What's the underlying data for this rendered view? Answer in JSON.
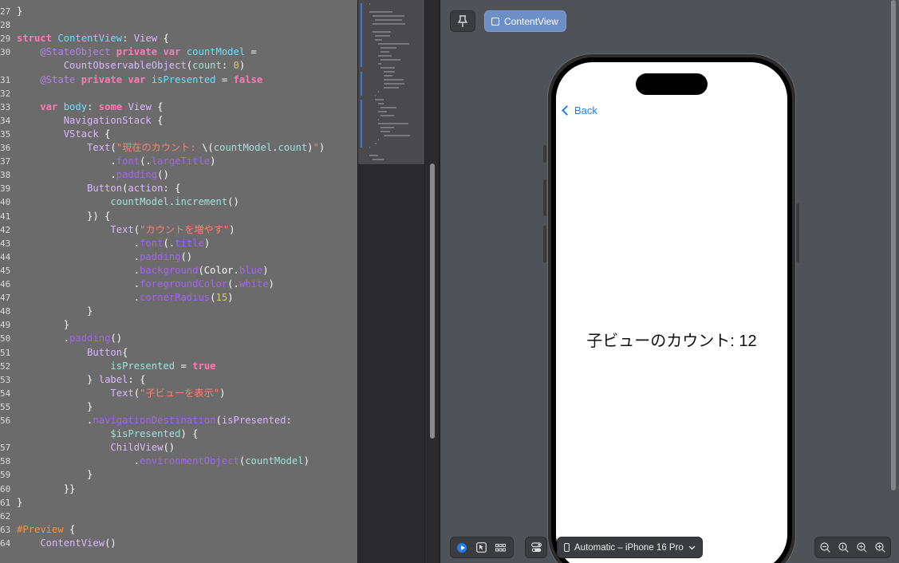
{
  "editor": {
    "lines": [
      {
        "n": "27",
        "segs": [
          {
            "t": "}",
            "c": "plain"
          }
        ]
      },
      {
        "n": "28",
        "segs": []
      },
      {
        "n": "29",
        "segs": [
          {
            "t": "struct ",
            "c": "kw"
          },
          {
            "t": "ContentView",
            "c": "var"
          },
          {
            "t": ": ",
            "c": "plain"
          },
          {
            "t": "View",
            "c": "tp2"
          },
          {
            "t": " {",
            "c": "plain"
          }
        ]
      },
      {
        "n": "30",
        "segs": [
          {
            "t": "    @StateObject ",
            "c": "attr"
          },
          {
            "t": "private var ",
            "c": "kw"
          },
          {
            "t": "countModel",
            "c": "var"
          },
          {
            "t": " =",
            "c": "plain"
          }
        ]
      },
      {
        "n": "",
        "segs": [
          {
            "t": "        CountObservableObject",
            "c": "tp2"
          },
          {
            "t": "(",
            "c": "plain"
          },
          {
            "t": "count",
            "c": "tp"
          },
          {
            "t": ": ",
            "c": "plain"
          },
          {
            "t": "0",
            "c": "num"
          },
          {
            "t": ")",
            "c": "plain"
          }
        ]
      },
      {
        "n": "31",
        "segs": [
          {
            "t": "    @State ",
            "c": "attr"
          },
          {
            "t": "private var ",
            "c": "kw"
          },
          {
            "t": "isPresented",
            "c": "var"
          },
          {
            "t": " = ",
            "c": "plain"
          },
          {
            "t": "false",
            "c": "kw"
          }
        ]
      },
      {
        "n": "32",
        "segs": []
      },
      {
        "n": "33",
        "segs": [
          {
            "t": "    var ",
            "c": "kw"
          },
          {
            "t": "body",
            "c": "var"
          },
          {
            "t": ": ",
            "c": "plain"
          },
          {
            "t": "some ",
            "c": "kw"
          },
          {
            "t": "View",
            "c": "tp2"
          },
          {
            "t": " {",
            "c": "plain"
          }
        ]
      },
      {
        "n": "34",
        "segs": [
          {
            "t": "        NavigationStack",
            "c": "tp2"
          },
          {
            "t": " {",
            "c": "plain"
          }
        ]
      },
      {
        "n": "35",
        "segs": [
          {
            "t": "        VStack",
            "c": "tp2"
          },
          {
            "t": " {",
            "c": "plain"
          }
        ]
      },
      {
        "n": "36",
        "segs": [
          {
            "t": "            Text",
            "c": "tp2"
          },
          {
            "t": "(",
            "c": "plain"
          },
          {
            "t": "\"現在のカウント: ",
            "c": "str"
          },
          {
            "t": "\\(",
            "c": "plain"
          },
          {
            "t": "countModel",
            "c": "tp"
          },
          {
            "t": ".",
            "c": "plain"
          },
          {
            "t": "count",
            "c": "tp"
          },
          {
            "t": ")",
            "c": "plain"
          },
          {
            "t": "\"",
            "c": "str"
          },
          {
            "t": ")",
            "c": "plain"
          }
        ]
      },
      {
        "n": "37",
        "segs": [
          {
            "t": "                .",
            "c": "plain"
          },
          {
            "t": "font",
            "c": "prop"
          },
          {
            "t": "(.",
            "c": "plain"
          },
          {
            "t": "largeTitle",
            "c": "prop"
          },
          {
            "t": ")",
            "c": "plain"
          }
        ]
      },
      {
        "n": "38",
        "segs": [
          {
            "t": "                .",
            "c": "plain"
          },
          {
            "t": "padding",
            "c": "prop"
          },
          {
            "t": "()",
            "c": "plain"
          }
        ]
      },
      {
        "n": "39",
        "segs": [
          {
            "t": "            Button",
            "c": "tp2"
          },
          {
            "t": "(",
            "c": "plain"
          },
          {
            "t": "action",
            "c": "tp2"
          },
          {
            "t": ": {",
            "c": "plain"
          }
        ]
      },
      {
        "n": "40",
        "segs": [
          {
            "t": "                countModel",
            "c": "tp"
          },
          {
            "t": ".",
            "c": "plain"
          },
          {
            "t": "increment",
            "c": "tp"
          },
          {
            "t": "()",
            "c": "plain"
          }
        ]
      },
      {
        "n": "41",
        "segs": [
          {
            "t": "            }) {",
            "c": "plain"
          }
        ]
      },
      {
        "n": "42",
        "segs": [
          {
            "t": "                Text",
            "c": "tp2"
          },
          {
            "t": "(",
            "c": "plain"
          },
          {
            "t": "\"カウントを増やす\"",
            "c": "str"
          },
          {
            "t": ")",
            "c": "plain"
          }
        ]
      },
      {
        "n": "43",
        "segs": [
          {
            "t": "                    .",
            "c": "plain"
          },
          {
            "t": "font",
            "c": "prop"
          },
          {
            "t": "(.",
            "c": "plain"
          },
          {
            "t": "title",
            "c": "prop"
          },
          {
            "t": ")",
            "c": "plain"
          }
        ]
      },
      {
        "n": "44",
        "segs": [
          {
            "t": "                    .",
            "c": "plain"
          },
          {
            "t": "padding",
            "c": "prop"
          },
          {
            "t": "()",
            "c": "plain"
          }
        ]
      },
      {
        "n": "45",
        "segs": [
          {
            "t": "                    .",
            "c": "plain"
          },
          {
            "t": "background",
            "c": "prop"
          },
          {
            "t": "(Color.",
            "c": "plain"
          },
          {
            "t": "blue",
            "c": "prop"
          },
          {
            "t": ")",
            "c": "plain"
          }
        ]
      },
      {
        "n": "46",
        "segs": [
          {
            "t": "                    .",
            "c": "plain"
          },
          {
            "t": "foregroundColor",
            "c": "prop"
          },
          {
            "t": "(.",
            "c": "plain"
          },
          {
            "t": "white",
            "c": "prop"
          },
          {
            "t": ")",
            "c": "plain"
          }
        ]
      },
      {
        "n": "47",
        "segs": [
          {
            "t": "                    .",
            "c": "plain"
          },
          {
            "t": "cornerRadius",
            "c": "prop"
          },
          {
            "t": "(",
            "c": "plain"
          },
          {
            "t": "15",
            "c": "num"
          },
          {
            "t": ")",
            "c": "plain"
          }
        ]
      },
      {
        "n": "48",
        "segs": [
          {
            "t": "            }",
            "c": "plain"
          }
        ]
      },
      {
        "n": "49",
        "segs": [
          {
            "t": "        }",
            "c": "plain"
          }
        ]
      },
      {
        "n": "50",
        "segs": [
          {
            "t": "        .",
            "c": "plain"
          },
          {
            "t": "padding",
            "c": "prop"
          },
          {
            "t": "()",
            "c": "plain"
          }
        ]
      },
      {
        "n": "51",
        "segs": [
          {
            "t": "            Button",
            "c": "tp2"
          },
          {
            "t": "{",
            "c": "plain"
          }
        ]
      },
      {
        "n": "52",
        "segs": [
          {
            "t": "                isPresented",
            "c": "tp"
          },
          {
            "t": " = ",
            "c": "plain"
          },
          {
            "t": "true",
            "c": "kw"
          }
        ]
      },
      {
        "n": "53",
        "segs": [
          {
            "t": "            } ",
            "c": "plain"
          },
          {
            "t": "label",
            "c": "tp2"
          },
          {
            "t": ": {",
            "c": "plain"
          }
        ]
      },
      {
        "n": "54",
        "segs": [
          {
            "t": "                Text",
            "c": "tp2"
          },
          {
            "t": "(",
            "c": "plain"
          },
          {
            "t": "\"子ビューを表示\"",
            "c": "str"
          },
          {
            "t": ")",
            "c": "plain"
          }
        ]
      },
      {
        "n": "55",
        "segs": [
          {
            "t": "            }",
            "c": "plain"
          }
        ]
      },
      {
        "n": "56",
        "segs": [
          {
            "t": "            .",
            "c": "plain"
          },
          {
            "t": "navigationDestination",
            "c": "prop"
          },
          {
            "t": "(",
            "c": "plain"
          },
          {
            "t": "isPresented",
            "c": "tp2"
          },
          {
            "t": ":",
            "c": "plain"
          }
        ]
      },
      {
        "n": "",
        "segs": [
          {
            "t": "                $isPresented",
            "c": "tp"
          },
          {
            "t": ") {",
            "c": "plain"
          }
        ]
      },
      {
        "n": "57",
        "segs": [
          {
            "t": "                ChildView",
            "c": "tp2"
          },
          {
            "t": "()",
            "c": "plain"
          }
        ]
      },
      {
        "n": "58",
        "segs": [
          {
            "t": "                    .",
            "c": "plain"
          },
          {
            "t": "environmentObject",
            "c": "prop"
          },
          {
            "t": "(",
            "c": "plain"
          },
          {
            "t": "countModel",
            "c": "tp"
          },
          {
            "t": ")",
            "c": "plain"
          }
        ]
      },
      {
        "n": "59",
        "segs": [
          {
            "t": "            }",
            "c": "plain"
          }
        ]
      },
      {
        "n": "60",
        "segs": [
          {
            "t": "        }}",
            "c": "plain"
          }
        ]
      },
      {
        "n": "61",
        "segs": [
          {
            "t": "}",
            "c": "plain"
          }
        ]
      },
      {
        "n": "62",
        "segs": []
      },
      {
        "n": "63",
        "segs": [
          {
            "t": "#Preview",
            "c": "macro"
          },
          {
            "t": " {",
            "c": "plain"
          }
        ]
      },
      {
        "n": "64",
        "segs": [
          {
            "t": "    ContentView",
            "c": "tp2"
          },
          {
            "t": "()",
            "c": "plain"
          }
        ]
      }
    ]
  },
  "canvas": {
    "pin_icon": "pin-icon",
    "tab_label": "ContentView",
    "phone": {
      "back_label": "Back",
      "count_text": "子ビューのカウント: 12"
    },
    "device_selector": "Automatic – iPhone 16 Pro",
    "accent_color": "#1a7dfb"
  }
}
